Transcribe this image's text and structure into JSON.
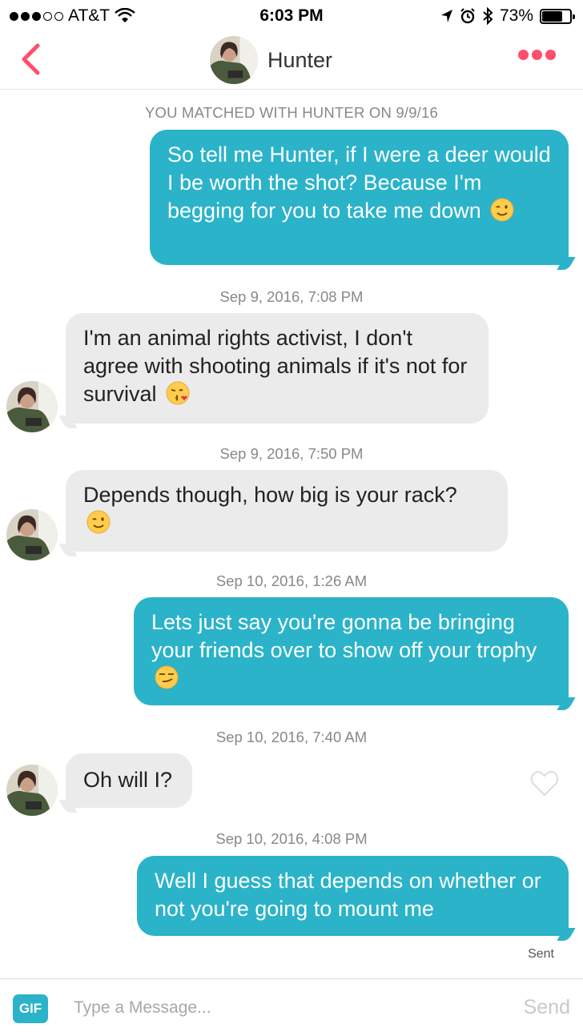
{
  "status_bar": {
    "carrier": "AT&T",
    "time": "6:03 PM",
    "battery": "73%",
    "battery_level": 0.73
  },
  "header": {
    "name": "Hunter"
  },
  "match_notice": "YOU MATCHED WITH HUNTER ON 9/9/16",
  "messages": [
    {
      "direction": "out",
      "text": "So tell me Hunter, if I were a deer would I be worth the shot? Because I'm begging for you to take me down",
      "emoji": "winking-face-emoji"
    },
    {
      "timestamp": "Sep 9, 2016, 7:08 PM"
    },
    {
      "direction": "in",
      "text": "I'm an animal rights activist, I don't agree with shooting animals if it's not for survival",
      "emoji": "face-blowing-kiss-emoji"
    },
    {
      "timestamp": "Sep 9, 2016, 7:50 PM"
    },
    {
      "direction": "in",
      "text": "Depends though, how big is your rack?",
      "emoji": "winking-face-emoji"
    },
    {
      "timestamp": "Sep 10, 2016, 1:26 AM"
    },
    {
      "direction": "out",
      "text": "Lets just say you're gonna be bringing your friends over to show off your trophy",
      "emoji": "smirking-face-emoji"
    },
    {
      "timestamp": "Sep 10, 2016, 7:40 AM"
    },
    {
      "direction": "in",
      "text": "Oh will I?"
    },
    {
      "timestamp": "Sep 10, 2016, 4:08 PM"
    },
    {
      "direction": "out",
      "text": "Well I guess that depends on whether or not you're going to mount me"
    }
  ],
  "sent_status": "Sent",
  "composer": {
    "gif_label": "GIF",
    "placeholder": "Type a Message...",
    "send_label": "Send"
  },
  "colors": {
    "outgoing_bubble": "#2ab3c9",
    "incoming_bubble": "#ebebeb",
    "accent": "#fe4f6d"
  }
}
